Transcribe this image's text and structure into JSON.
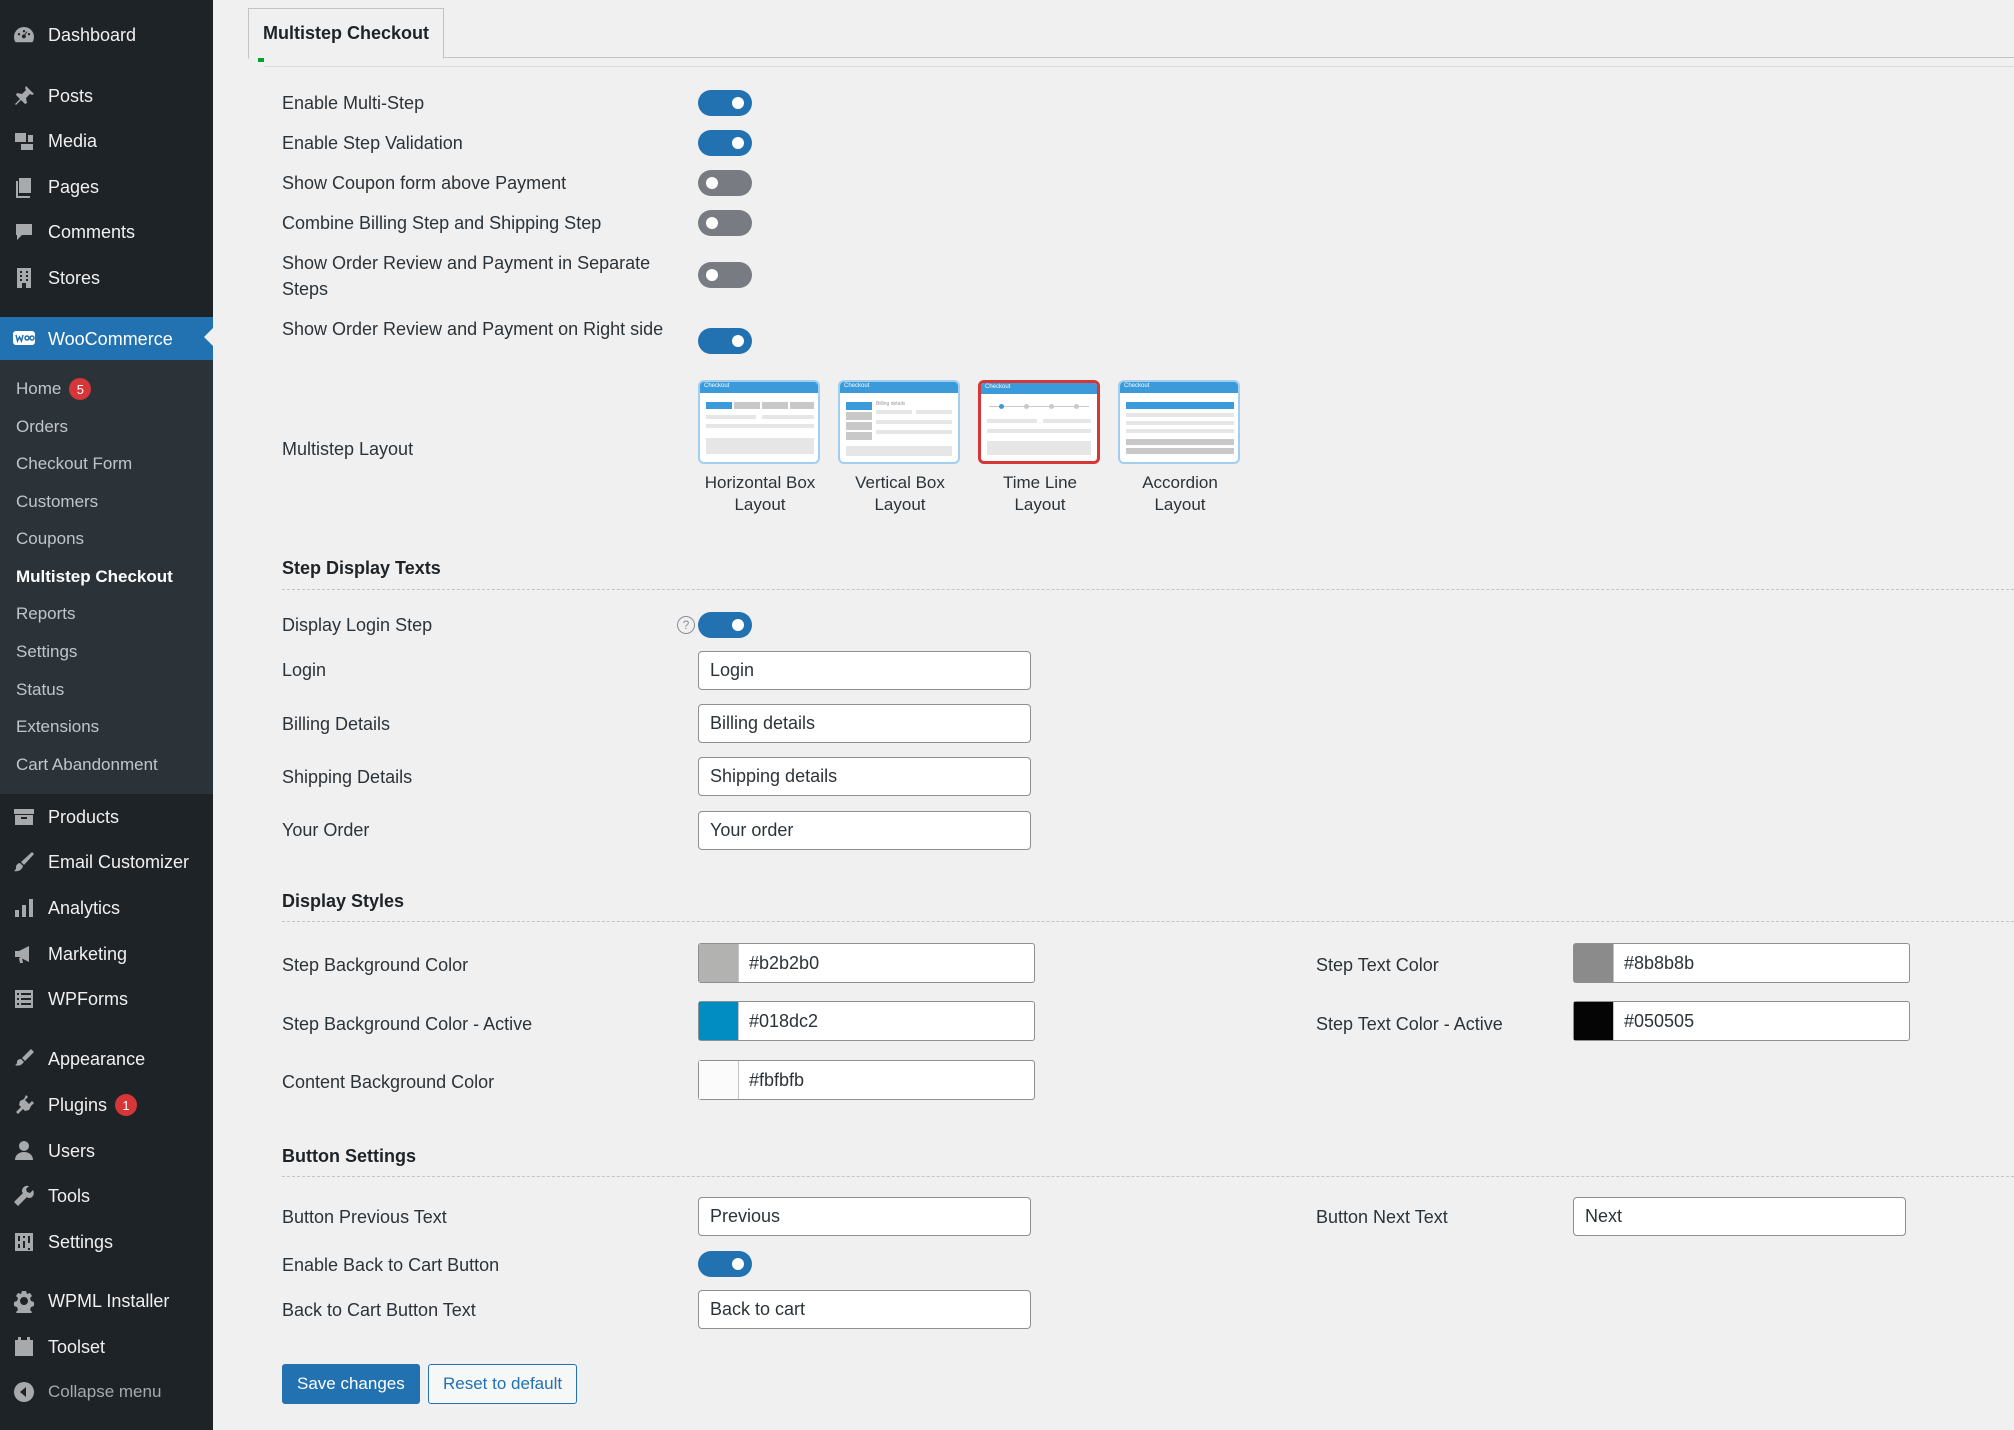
{
  "sidebar": {
    "dashboard": "Dashboard",
    "posts": "Posts",
    "media": "Media",
    "pages": "Pages",
    "comments": "Comments",
    "stores": "Stores",
    "woocommerce": "WooCommerce",
    "sub": {
      "home": "Home",
      "home_badge": "5",
      "orders": "Orders",
      "checkout_form": "Checkout Form",
      "customers": "Customers",
      "coupons": "Coupons",
      "multistep_checkout": "Multistep Checkout",
      "reports": "Reports",
      "settings": "Settings",
      "status": "Status",
      "extensions": "Extensions",
      "cart_abandonment": "Cart Abandonment"
    },
    "products": "Products",
    "email_customizer": "Email Customizer",
    "analytics": "Analytics",
    "marketing": "Marketing",
    "wpforms": "WPForms",
    "appearance": "Appearance",
    "plugins": "Plugins",
    "plugins_badge": "1",
    "users": "Users",
    "tools": "Tools",
    "settings": "Settings",
    "wpml_installer": "WPML Installer",
    "toolset": "Toolset",
    "collapse": "Collapse menu"
  },
  "tab": {
    "label": "Multistep Checkout"
  },
  "general": {
    "enable_multistep": {
      "label": "Enable Multi-Step",
      "on": true
    },
    "enable_validation": {
      "label": "Enable Step Validation",
      "on": true
    },
    "coupon_above_payment": {
      "label": "Show Coupon form above Payment",
      "on": false
    },
    "combine_billing_shipping": {
      "label": "Combine Billing Step and Shipping Step",
      "on": false
    },
    "separate_review_payment": {
      "label": "Show Order Review and Payment in Separate Steps",
      "on": false
    },
    "review_right_side": {
      "label": "Show Order Review and Payment on Right side",
      "on": true
    }
  },
  "layout": {
    "label": "Multistep Layout",
    "options": [
      {
        "name": "Horizontal Box Layout",
        "thumb_title": "Checkout"
      },
      {
        "name": "Vertical Box Layout",
        "thumb_title": "Checkout"
      },
      {
        "name": "Time Line Layout",
        "thumb_title": "Checkout",
        "selected": true
      },
      {
        "name": "Accordion Layout",
        "thumb_title": "Checkout"
      }
    ],
    "vertical_thumb_text": "Billing details"
  },
  "step_texts": {
    "title": "Step Display Texts",
    "display_login": {
      "label": "Display Login Step",
      "on": true,
      "help": "?"
    },
    "login": {
      "label": "Login",
      "value": "Login"
    },
    "billing": {
      "label": "Billing Details",
      "value": "Billing details"
    },
    "shipping": {
      "label": "Shipping Details",
      "value": "Shipping details"
    },
    "order": {
      "label": "Your Order",
      "value": "Your order"
    }
  },
  "styles": {
    "title": "Display Styles",
    "step_bg": {
      "label": "Step Background Color",
      "value": "#b2b2b0"
    },
    "step_bg_active": {
      "label": "Step Background Color - Active",
      "value": "#018dc2"
    },
    "content_bg": {
      "label": "Content Background Color",
      "value": "#fbfbfb"
    },
    "step_text": {
      "label": "Step Text Color",
      "value": "#8b8b8b"
    },
    "step_text_active": {
      "label": "Step Text Color - Active",
      "value": "#050505"
    }
  },
  "buttons": {
    "title": "Button Settings",
    "prev": {
      "label": "Button Previous Text",
      "value": "Previous"
    },
    "next": {
      "label": "Button Next Text",
      "value": "Next"
    },
    "back_to_cart": {
      "label": "Enable Back to Cart Button",
      "on": true
    },
    "back_text": {
      "label": "Back to Cart Button Text",
      "value": "Back to cart"
    }
  },
  "actions": {
    "save": "Save changes",
    "reset": "Reset to default"
  },
  "colors": {
    "accent": "#2271b1",
    "sidebar": "#1d2327",
    "submenu": "#2c3338",
    "badge": "#d63638",
    "selected_layout": "#d63638"
  }
}
